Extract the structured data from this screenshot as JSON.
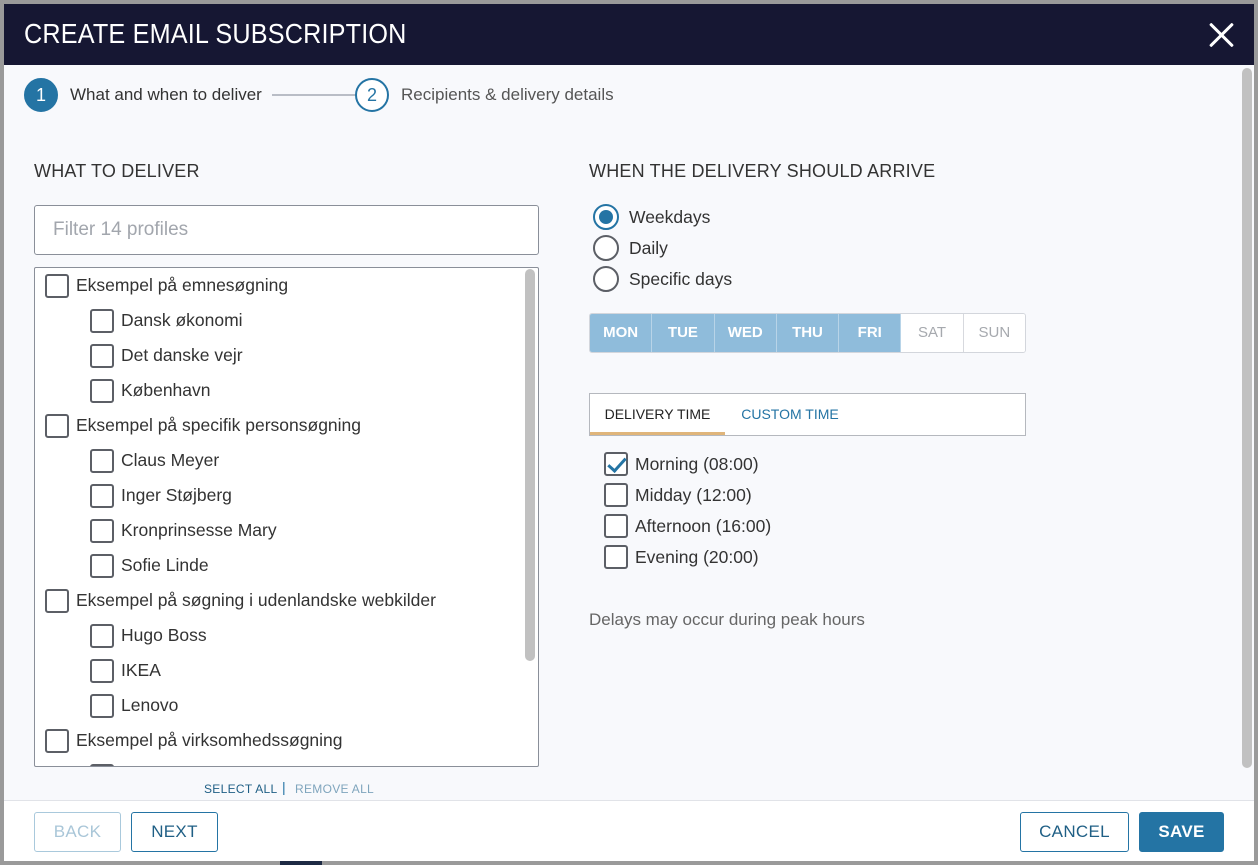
{
  "dialog": {
    "title": "CREATE EMAIL SUBSCRIPTION"
  },
  "stepper": {
    "steps": [
      {
        "number": "1",
        "label": "What and when to deliver",
        "active": true
      },
      {
        "number": "2",
        "label": "Recipients & delivery details",
        "active": false
      }
    ]
  },
  "what": {
    "heading": "WHAT TO DELIVER",
    "filter_placeholder": "Filter 14 profiles",
    "filter_value": "",
    "groups": [
      {
        "label": "Eksempel på emnesøgning",
        "checked": false,
        "items": [
          {
            "label": "Dansk økonomi",
            "checked": false
          },
          {
            "label": "Det danske vejr",
            "checked": false
          },
          {
            "label": "København",
            "checked": false
          }
        ]
      },
      {
        "label": "Eksempel på specifik personsøgning",
        "checked": false,
        "items": [
          {
            "label": "Claus Meyer",
            "checked": false
          },
          {
            "label": "Inger Støjberg",
            "checked": false
          },
          {
            "label": "Kronprinsesse Mary",
            "checked": false
          },
          {
            "label": "Sofie Linde",
            "checked": false
          }
        ]
      },
      {
        "label": "Eksempel på søgning i udenlandske webkilder",
        "checked": false,
        "items": [
          {
            "label": "Hugo Boss",
            "checked": false
          },
          {
            "label": "IKEA",
            "checked": false
          },
          {
            "label": "Lenovo",
            "checked": false
          }
        ]
      },
      {
        "label": "Eksempel på virksomhedssøgning",
        "checked": false,
        "items": [
          {
            "label": "",
            "checked": false
          }
        ]
      }
    ],
    "select_all": "SELECT ALL",
    "separator": "|",
    "remove_all": "REMOVE ALL"
  },
  "when": {
    "heading": "WHEN THE DELIVERY SHOULD ARRIVE",
    "frequency_options": [
      {
        "label": "Weekdays",
        "selected": true
      },
      {
        "label": "Daily",
        "selected": false
      },
      {
        "label": "Specific days",
        "selected": false
      }
    ],
    "days": [
      {
        "label": "MON",
        "on": true
      },
      {
        "label": "TUE",
        "on": true
      },
      {
        "label": "WED",
        "on": true
      },
      {
        "label": "THU",
        "on": true
      },
      {
        "label": "FRI",
        "on": true
      },
      {
        "label": "SAT",
        "on": false
      },
      {
        "label": "SUN",
        "on": false
      }
    ],
    "tabs": {
      "delivery_time": "DELIVERY TIME",
      "custom_time": "CUSTOM TIME"
    },
    "times": [
      {
        "label": "Morning (08:00)",
        "checked": true
      },
      {
        "label": "Midday (12:00)",
        "checked": false
      },
      {
        "label": "Afternoon (16:00)",
        "checked": false
      },
      {
        "label": "Evening (20:00)",
        "checked": false
      }
    ],
    "note": "Delays may occur during peak hours"
  },
  "footer": {
    "back": "BACK",
    "next": "NEXT",
    "cancel": "CANCEL",
    "save": "SAVE"
  },
  "colors": {
    "titlebar": "#161733",
    "accent": "#2474a4",
    "day_on": "#8fbcdb"
  }
}
